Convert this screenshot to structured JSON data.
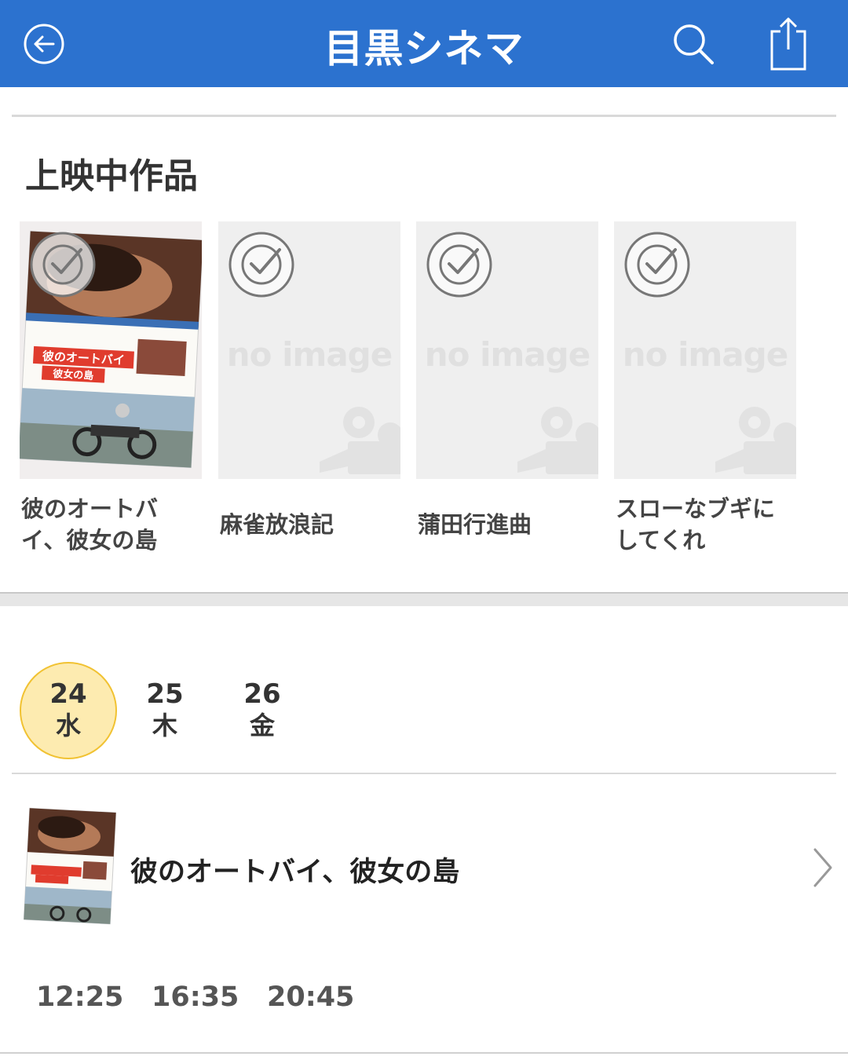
{
  "header": {
    "title": "目黒シネマ",
    "color": "#2c72cf"
  },
  "section": {
    "title": "上映中作品"
  },
  "movies": [
    {
      "title": "彼のオートバイ、彼女の島",
      "has_image": true
    },
    {
      "title": "麻雀放浪記",
      "has_image": false,
      "placeholder": "no image"
    },
    {
      "title": "蒲田行進曲",
      "has_image": false,
      "placeholder": "no image"
    },
    {
      "title": "スローなブギにしてくれ",
      "has_image": false,
      "placeholder": "no image"
    }
  ],
  "poster_text": {
    "main": "彼のオートバイ",
    "sub": "彼女の島"
  },
  "dates": [
    {
      "day": "24",
      "weekday": "水",
      "selected": true
    },
    {
      "day": "25",
      "weekday": "木",
      "selected": false
    },
    {
      "day": "26",
      "weekday": "金",
      "selected": false
    }
  ],
  "schedule": {
    "title": "彼のオートバイ、彼女の島",
    "times": [
      "12:25",
      "16:35",
      "20:45"
    ]
  },
  "icons": {
    "back": "back-arrow-icon",
    "search": "search-icon",
    "share": "share-icon",
    "check": "check-circle-icon",
    "camera": "movie-camera-icon",
    "chevron": "chevron-right-icon"
  },
  "colors": {
    "selected_date_bg": "#fdebb0",
    "selected_date_border": "#f1c232"
  }
}
